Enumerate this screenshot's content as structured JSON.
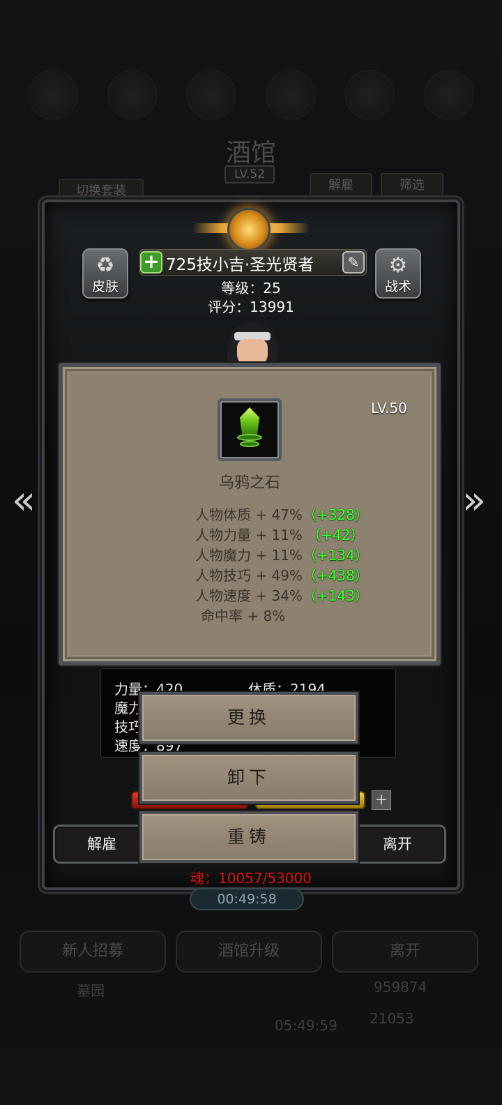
{
  "background": {
    "title": "酒馆",
    "level": "LV.52",
    "switch_outfit": "切换套装",
    "dismiss": "解雇",
    "filter": "筛选",
    "bottom_buttons": [
      "新人招募",
      "酒馆升级",
      "离开"
    ],
    "cemetery": "墓园",
    "gold": "959874",
    "gems": "21053",
    "bottom_timer": "05:49:59"
  },
  "hero": {
    "name": "725技小吉·圣光贤者",
    "level_line": "等级：25",
    "score_line": "评分：13991",
    "skin_label": "皮肤",
    "tactics_label": "战术"
  },
  "item": {
    "level": "LV.50",
    "name": "乌鸦之石",
    "attributes": [
      {
        "text": "人物体质 + 47%",
        "bonus": "（+328）"
      },
      {
        "text": "人物力量 + 11%",
        "bonus": " （+42）"
      },
      {
        "text": "人物魔力 + 11%",
        "bonus": "（+134）"
      },
      {
        "text": "人物技巧 + 49%",
        "bonus": "（+438）"
      },
      {
        "text": "人物速度 + 34%",
        "bonus": "（+143）"
      },
      {
        "text": " 命中率 + 8%",
        "bonus": ""
      }
    ]
  },
  "stats_partial": {
    "strength": "力量：420",
    "constitution": "休质：2194",
    "magic": "魔力",
    "skill": "技巧",
    "speed": "速度：897"
  },
  "actions": {
    "replace": "更换",
    "unequip": "卸下",
    "reforge": "重铸"
  },
  "panel": {
    "dismiss": "解雇",
    "leave": "离开",
    "soul": "魂：10057/53000",
    "timer": "00:49:58"
  },
  "colors": {
    "accent_gold": "#e6a53a",
    "bonus_green": "#3cff2c",
    "soul_red": "#e01414",
    "dialog_bg": "#8d8170"
  }
}
